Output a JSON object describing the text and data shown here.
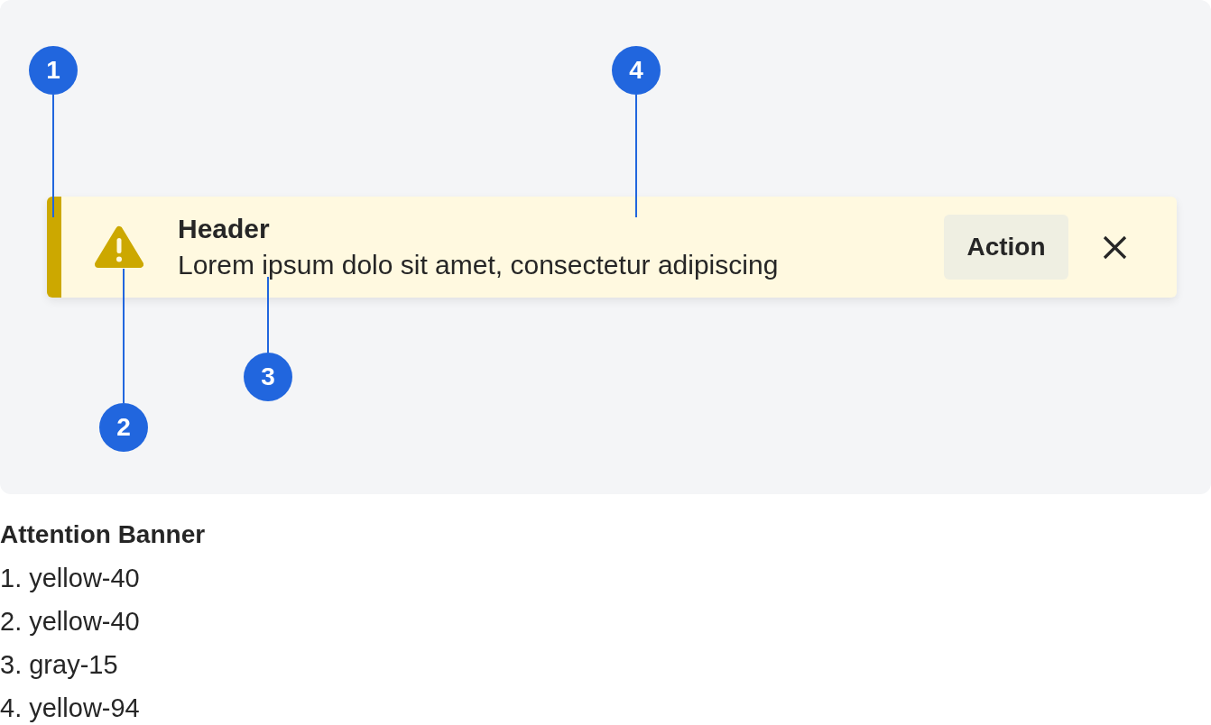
{
  "canvas": {
    "banner": {
      "header": "Header",
      "message": "Lorem ipsum dolo sit amet, consectetur adipiscing",
      "action": "Action"
    },
    "callouts": [
      {
        "number": "1"
      },
      {
        "number": "2"
      },
      {
        "number": "3"
      },
      {
        "number": "4"
      }
    ]
  },
  "legend": {
    "title": "Attention Banner",
    "items": [
      "1. yellow-40",
      "2. yellow-40",
      "3. gray-15",
      "4. yellow-94"
    ]
  }
}
